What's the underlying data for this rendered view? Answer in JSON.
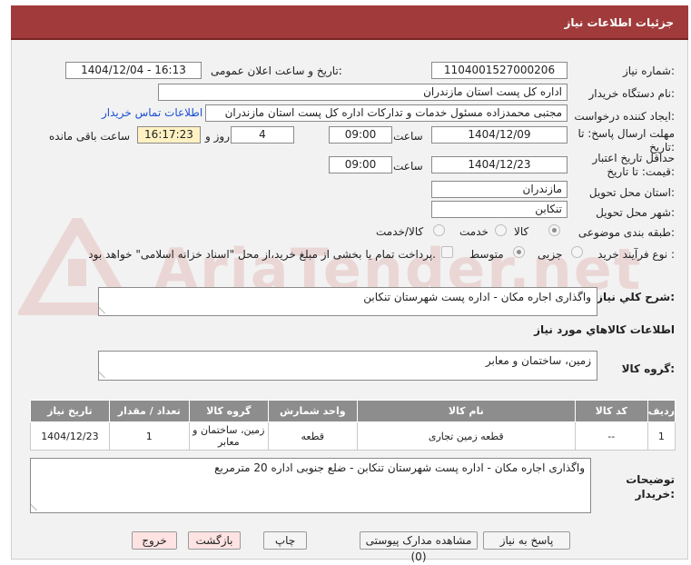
{
  "header": {
    "title": "جزئیات اطلاعات نیاز"
  },
  "labels": {
    "need_number": "شماره نیاز:",
    "announce_datetime": "تاریخ و ساعت اعلان عمومی:",
    "buyer_org": "نام دستگاه خریدار:",
    "requester": "ایجاد کننده درخواست:",
    "reply_deadline": "مهلت ارسال پاسخ: تا تاریخ:",
    "time": "ساعت",
    "days_and": "روز و",
    "remaining": "ساعت باقی مانده",
    "price_validity": "حداقل تاریخ اعتبار قیمت: تا تاریخ:",
    "delivery_province": "استان محل تحویل:",
    "delivery_city": "شهر محل تحویل:",
    "category": "طبقه بندی موضوعی:",
    "purchase_type": "نوع فرآیند خرید :",
    "overall_desc": "شرح کلي نياز:",
    "goods_info": "اطلاعات کالاهاي مورد نياز",
    "goods_group": "گروه کالا:",
    "buyer_notes": "توضیحات خریدار:"
  },
  "values": {
    "need_number": "1104001527000206",
    "announce_datetime": "1404/12/04 - 16:13",
    "buyer_org": "اداره کل پست استان مازندران",
    "requester": "مجتبی محمدزاده مسئول خدمات و تدارکات اداره کل پست استان مازندران",
    "contact_link": "اطلاعات تماس خریدار",
    "reply_date": "1404/12/09",
    "reply_time": "09:00",
    "remaining_days": "4",
    "remaining_time": "16:17:23",
    "validity_date": "1404/12/23",
    "validity_time": "09:00",
    "province": "مازندران",
    "city": "تنکابن",
    "overall_desc": "واگذاری اجاره مکان - اداره پست شهرستان تنکابن",
    "goods_group": "زمین، ساختمان و معابر",
    "buyer_notes": "واگذاری اجاره مکان - اداره پست شهرستان تنکابن - ضلع جنوبی اداره 20 مترمربع"
  },
  "category_options": [
    "کالا",
    "خدمت",
    "کالا/خدمت"
  ],
  "purchase_options": [
    "جزیی",
    "متوسط"
  ],
  "purchase_note": "پرداخت تمام یا بخشی از مبلغ خرید،از محل \"اسناد خزانه اسلامی\" خواهد بود.",
  "table": {
    "headers": [
      "ردیف",
      "کد کالا",
      "نام کالا",
      "واحد شمارش",
      "گروه کالا",
      "تعداد / مقدار",
      "تاریخ نیاز"
    ],
    "rows": [
      [
        "1",
        "--",
        "قطعه زمین تجاری",
        "قطعه",
        "زمین، ساختمان و معابر",
        "1",
        "1404/12/23"
      ]
    ]
  },
  "buttons": {
    "reply": "پاسخ به نیاز",
    "attachments": "مشاهده مدارک پیوستی (0)",
    "print": "چاپ",
    "back": "بازگشت",
    "exit": "خروج"
  },
  "watermark": "AriaTender.net",
  "colors": {
    "header": "#a13b3b",
    "table_header": "#8d8d8d",
    "link": "#1a4fd6",
    "remaining_bg": "#fff1c2"
  }
}
